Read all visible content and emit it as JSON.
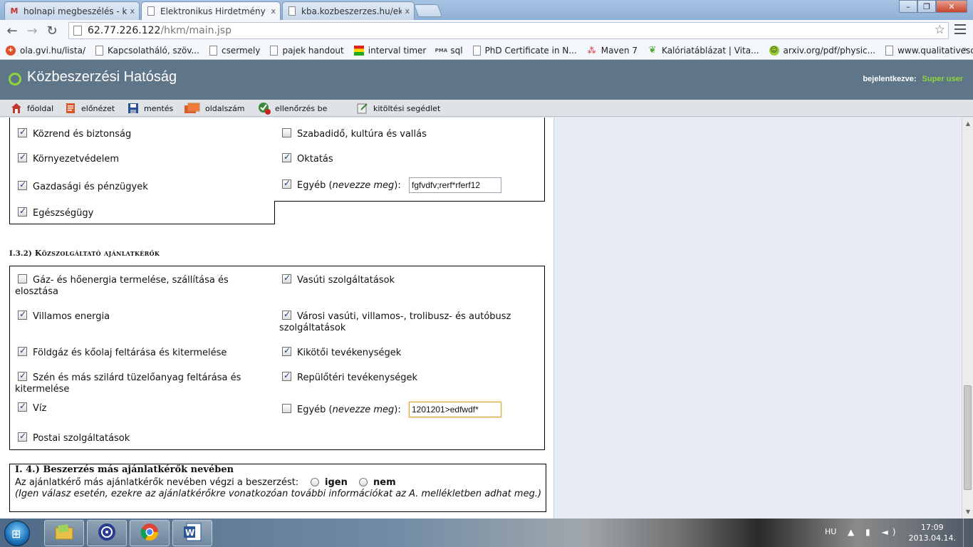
{
  "browser": {
    "tabs": [
      {
        "title": "holnapi megbeszélés - kin",
        "icon": "gmail-icon"
      },
      {
        "title": "Elektronikus Hirdetmény F",
        "icon": "page-icon"
      },
      {
        "title": "kba.kozbeszerzes.hu/ekt/p",
        "icon": "page-icon"
      }
    ],
    "tab_close": "x",
    "url_host": "62.77.226.122",
    "url_path": "/hkm/main.jsp",
    "bookmarks": [
      {
        "label": "ola.gvi.hu/lista/",
        "icon": "plus-circle-icon"
      },
      {
        "label": "Kapcsolatháló, szöv...",
        "icon": "page-icon"
      },
      {
        "label": "csermely",
        "icon": "page-icon"
      },
      {
        "label": "pajek handout",
        "icon": "page-icon"
      },
      {
        "label": "interval timer",
        "icon": "flag-icon"
      },
      {
        "label": "sql",
        "icon": "pma-icon"
      },
      {
        "label": "PhD Certificate in N...",
        "icon": "page-icon"
      },
      {
        "label": "Maven 7",
        "icon": "molecule-icon"
      },
      {
        "label": "Kalóriatáblázat | Vita...",
        "icon": "leaf-icon"
      },
      {
        "label": "arxiv.org/pdf/physic...",
        "icon": "smiley-icon"
      },
      {
        "label": "www.qualitativesoci...",
        "icon": "page-icon"
      }
    ],
    "bookmarks_more": "»"
  },
  "site": {
    "title": "Közbeszerzési Hatóság",
    "login_label": "bejelentkezve:",
    "login_user": "Super user",
    "toolbar": [
      {
        "label": "főoldal",
        "icon": "home-icon"
      },
      {
        "label": "előnézet",
        "icon": "preview-icon"
      },
      {
        "label": "mentés",
        "icon": "save-icon"
      },
      {
        "label": "oldalszám",
        "icon": "pages-icon"
      },
      {
        "label": "ellenőrzés be",
        "icon": "check-icon"
      },
      {
        "label": "kitöltési segédlet",
        "icon": "help-icon"
      }
    ]
  },
  "form": {
    "top_left": [
      {
        "label": "Közrend és biztonság",
        "checked": true
      },
      {
        "label": "Környezetvédelem",
        "checked": true
      },
      {
        "label": "Gazdasági és pénzügyek",
        "checked": true
      },
      {
        "label": "Egészségügy",
        "checked": true
      }
    ],
    "top_right": [
      {
        "label": "Szabadidő, kultúra és vallás",
        "checked": false
      },
      {
        "label": "Oktatás",
        "checked": true
      }
    ],
    "top_other": {
      "label_pre": "Egyéb (",
      "label_em": "nevezze meg",
      "label_post": "):",
      "checked": true,
      "value": "fgfvdfv;rerf*rferf12"
    },
    "section_i32": {
      "prefix": "I.3.2)",
      "title": "Közszolgáltató ajánlatkérők"
    },
    "util_left": [
      {
        "label": "Gáz- és hőenergia termelése, szállítása és elosztása",
        "checked": false
      },
      {
        "label": "Villamos energia",
        "checked": true
      },
      {
        "label": "Földgáz és kőolaj feltárása és kitermelése",
        "checked": true
      },
      {
        "label": "Szén és más szilárd tüzelőanyag feltárása és kitermelése",
        "checked": true
      },
      {
        "label": "Víz",
        "checked": true
      },
      {
        "label": "Postai szolgáltatások",
        "checked": true
      }
    ],
    "util_right": [
      {
        "label": "Vasúti szolgáltatások",
        "checked": true
      },
      {
        "label": "Városi vasúti, villamos-, trolibusz- és autóbusz szolgáltatások",
        "checked": true
      },
      {
        "label": "Kikötői tevékenységek",
        "checked": true
      },
      {
        "label": "Repülőtéri tevékenységek",
        "checked": true
      }
    ],
    "util_other": {
      "label_pre": "Egyéb (",
      "label_em": "nevezze meg",
      "label_post": "):",
      "checked": false,
      "value": "1201201>edfwdf*"
    },
    "section_i4": {
      "title": "I. 4.) Beszerzés más ajánlatkérők nevében",
      "question": "Az ajánlatkérő más ajánlatkérők nevében végzi a beszerzést:",
      "yes": "igen",
      "no": "nem",
      "note": "(Igen válasz esetén, ezekre az ajánlatkérőkre vonatkozóan további információkat az A. mellékletben adhat meg.)"
    }
  },
  "taskbar": {
    "apps": [
      "explorer-icon",
      "torrent-icon",
      "chrome-icon",
      "word-icon"
    ],
    "lang": "HU",
    "time": "17:09",
    "date": "2013.04.14."
  }
}
